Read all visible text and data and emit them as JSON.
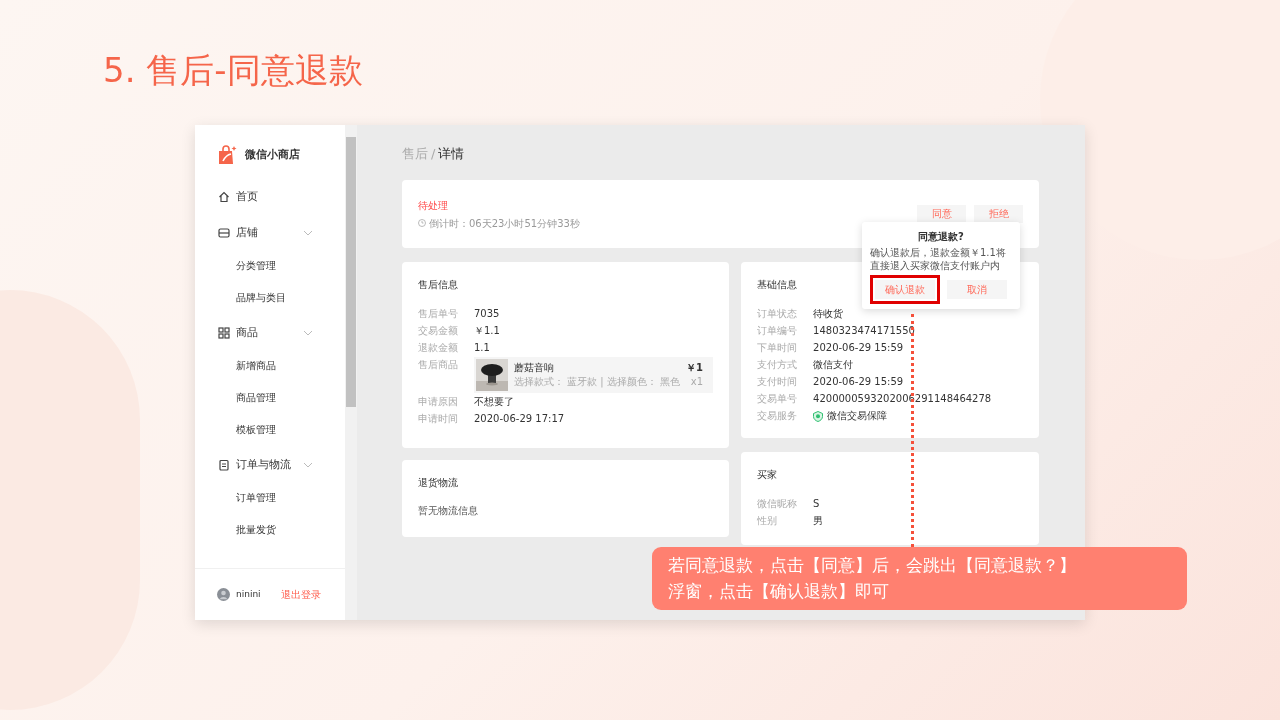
{
  "slide": {
    "title": "5. 售后-同意退款",
    "callout": {
      "lines": [
        "若同意退款，点击【同意】后，会跳出【同意退款？】",
        "浮窗，点击【确认退款】即可"
      ]
    }
  },
  "sidebar": {
    "logo_text": "微信小商店",
    "nav": [
      {
        "label": "首页"
      },
      {
        "label": "店铺",
        "expanded": true,
        "children": [
          {
            "label": "分类管理"
          },
          {
            "label": "品牌与类目"
          }
        ]
      },
      {
        "label": "商品",
        "expanded": true,
        "children": [
          {
            "label": "新增商品"
          },
          {
            "label": "商品管理"
          },
          {
            "label": "模板管理"
          }
        ]
      },
      {
        "label": "订单与物流",
        "expanded": true,
        "children": [
          {
            "label": "订单管理"
          },
          {
            "label": "批量发货"
          }
        ]
      }
    ],
    "user": {
      "name": "ninini",
      "logout": "退出登录"
    }
  },
  "breadcrumb": {
    "parent": "售后",
    "separator": "/",
    "current": "详情"
  },
  "status_card": {
    "status": "待处理",
    "countdown": "倒计时：06天23小时51分钟33秒",
    "buttons": [
      {
        "label": "同意"
      },
      {
        "label": "拒绝"
      }
    ]
  },
  "popover": {
    "title": "同意退款?",
    "message": "确认退款后，退款金额￥1.1将直接退入买家微信支付账户内",
    "buttons": [
      {
        "label": "确认退款",
        "highlighted": true
      },
      {
        "label": "取消",
        "highlighted": false
      }
    ]
  },
  "left_sections": [
    {
      "title": "售后信息",
      "rows": [
        {
          "kind": "text",
          "label": "售后单号",
          "value": "7035"
        },
        {
          "kind": "text",
          "label": "交易金额",
          "value": "￥1.1"
        },
        {
          "kind": "text",
          "label": "退款金额",
          "value": "1.1"
        },
        {
          "kind": "product",
          "label": "售后商品",
          "name": "蘑菇音响",
          "spec": "选择款式： 蓝牙款 | 选择颜色： 黑色",
          "price": "￥1",
          "quantity": "x1"
        },
        {
          "kind": "text",
          "label": "申请原因",
          "value": "不想要了"
        },
        {
          "kind": "text",
          "label": "申请时间",
          "value": "2020-06-29 17:17"
        }
      ]
    },
    {
      "title": "退货物流",
      "note": "暂无物流信息"
    }
  ],
  "right_sections": [
    {
      "title": "基础信息",
      "rows": [
        {
          "kind": "text",
          "label": "订单状态",
          "value": "待收货"
        },
        {
          "kind": "text",
          "label": "订单编号",
          "value": "1480323474171550"
        },
        {
          "kind": "text",
          "label": "下单时间",
          "value": "2020-06-29 15:59"
        },
        {
          "kind": "text",
          "label": "支付方式",
          "value": "微信支付"
        },
        {
          "kind": "text",
          "label": "支付时间",
          "value": "2020-06-29 15:59"
        },
        {
          "kind": "text",
          "label": "交易单号",
          "value": "4200000593202006291148464278"
        },
        {
          "kind": "service",
          "label": "交易服务",
          "value": "微信交易保障"
        }
      ]
    },
    {
      "title": "买家",
      "rows": [
        {
          "kind": "text",
          "label": "微信昵称",
          "value": "S"
        },
        {
          "kind": "text",
          "label": "性别",
          "value": "男"
        }
      ]
    }
  ]
}
